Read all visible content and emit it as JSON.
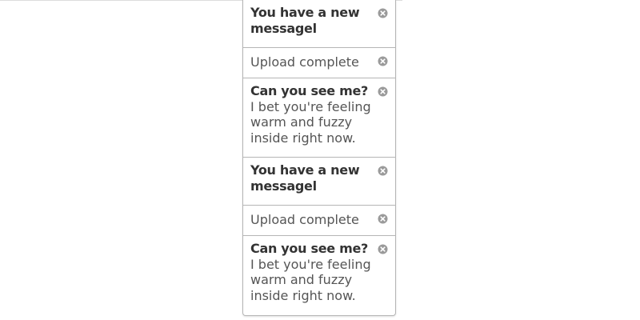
{
  "notifications": [
    {
      "title": "You have a new messagel",
      "body": ""
    },
    {
      "title": "",
      "body": "Upload complete"
    },
    {
      "title": "Can you see me?",
      "body": " I bet you're feeling warm and fuzzy inside right now."
    },
    {
      "title": "You have a new messagel",
      "body": ""
    },
    {
      "title": "",
      "body": "Upload complete"
    },
    {
      "title": "Can you see me?",
      "body": " I bet you're feeling warm and fuzzy inside right now."
    }
  ]
}
